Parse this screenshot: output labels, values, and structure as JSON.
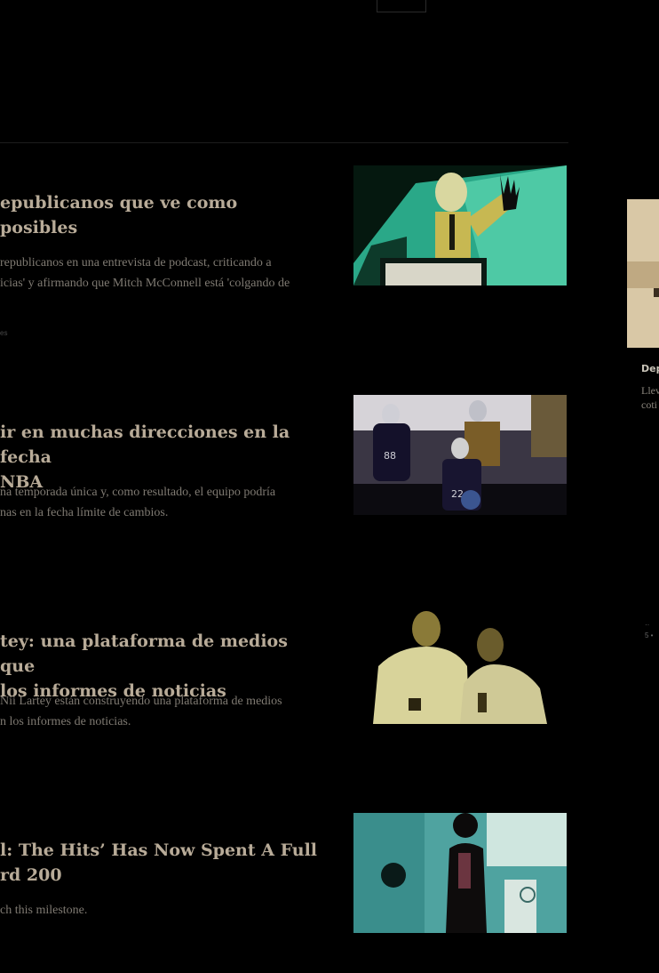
{
  "articles": [
    {
      "headline": "epublicanos que ve como posibles",
      "summary": "republicanos en una entrevista de podcast, criticando a\nicias' y afirmando que Mitch McConnell está 'colgando de",
      "meta": "es",
      "image_icon": "podium-waving-photo"
    },
    {
      "headline": "ir en muchas direcciones en la fecha\n NBA",
      "summary": "na temporada única y, como resultado, el equipo podría\nnas en la fecha límite de cambios.",
      "image_icon": "basketball-indiana-photo"
    },
    {
      "headline": "tey: una plataforma de medios que\n los informes de noticias",
      "summary": "Nii Lartey están construyendo una plataforma de medios\nn los informes de noticias.",
      "image_icon": "two-men-portrait-photo"
    },
    {
      "headline": "l: The Hits’ Has Now Spent A Full\nrd 200",
      "summary": "ch this milestone.",
      "image_icon": "performer-photo"
    }
  ],
  "sidebar": {
    "label": "Dep",
    "text": "Llev\ncoti",
    "dots": "··\n5 •"
  },
  "colors": {
    "background": "#000000",
    "headline": "#b8ab98",
    "summary": "#7f7a72"
  }
}
